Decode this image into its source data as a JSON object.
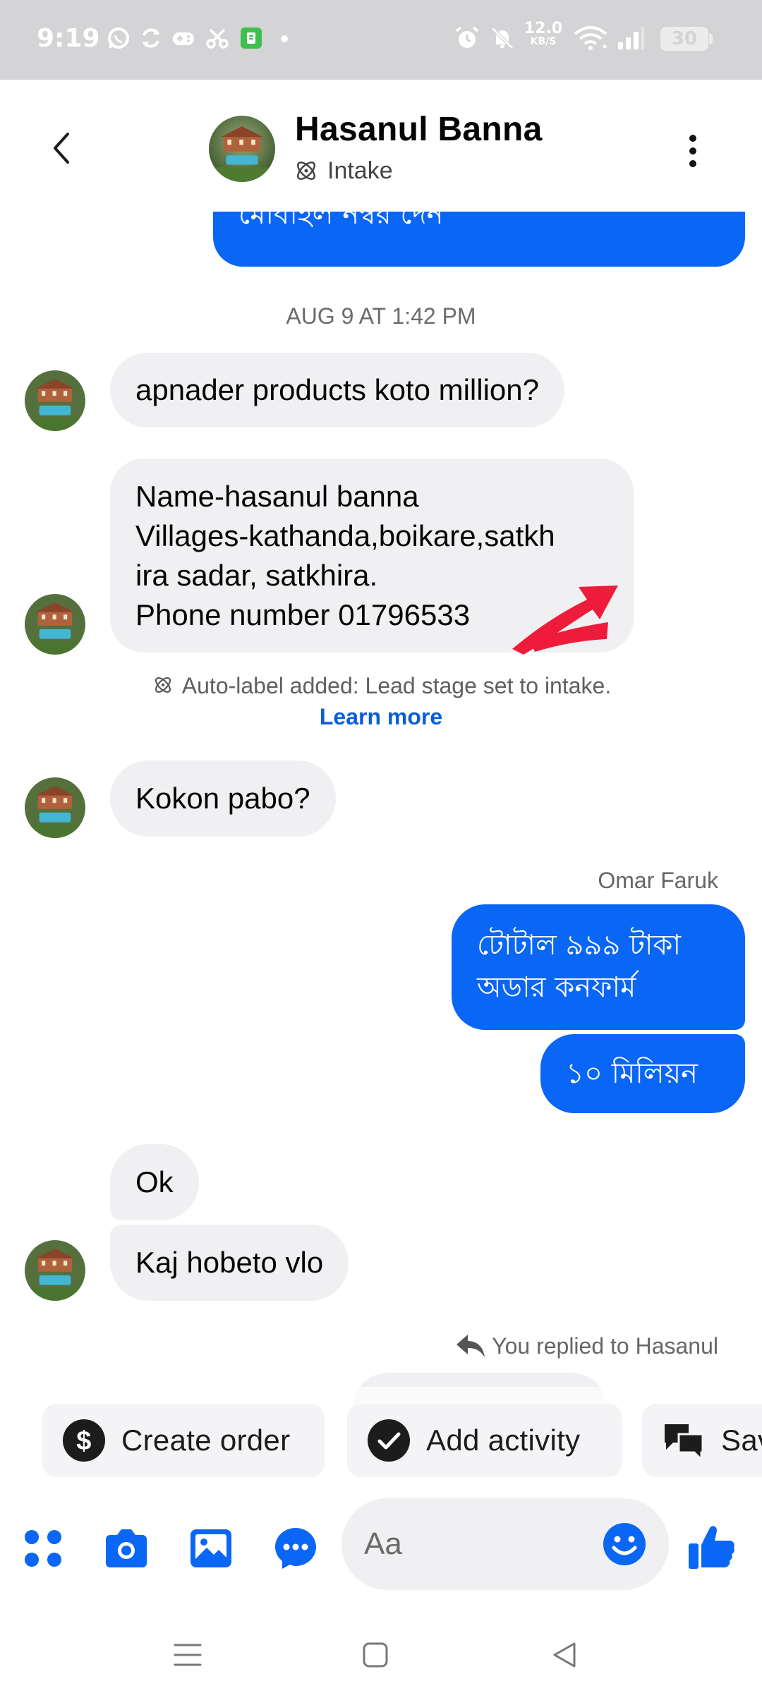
{
  "status_bar": {
    "time": "9:19",
    "net_speed_value": "12.0",
    "net_speed_unit": "KB/S",
    "battery": "30"
  },
  "header": {
    "contact_name": "Hasanul Banna",
    "label": "Intake"
  },
  "messages": {
    "top_partial": "মোবাইল নম্বর দেন",
    "timestamp": "AUG 9 AT 1:42 PM",
    "m1": "apnader products koto million?",
    "m2_lines": [
      "Name-hasanul banna",
      "Villages-kathanda,boikare,satkh",
      "ira sadar, satkhira.",
      "Phone number  01796533"
    ],
    "auto_label_text": "Auto-label added: Lead stage set to intake.",
    "auto_label_link": "Learn more",
    "m3": "Kokon pabo?",
    "sender_name": "Omar Faruk",
    "out1_lines": [
      "টোটাল ৯৯৯ টাকা",
      "অডার কনফার্ম"
    ],
    "out2": "১০ মিলিয়ন",
    "m4": "Ok",
    "m5": "Kaj hobeto vlo",
    "reply_note": "You replied to Hasanul"
  },
  "actions": {
    "create_order": "Create order",
    "add_activity": "Add activity",
    "saved_replies": "Sav"
  },
  "composer": {
    "placeholder": "Aa"
  },
  "colors": {
    "accent": "#0a66f5",
    "incoming_bubble": "#f0f0f2",
    "status_bar": "#d4d4d6",
    "annotation_arrow": "#ee1c3a"
  }
}
